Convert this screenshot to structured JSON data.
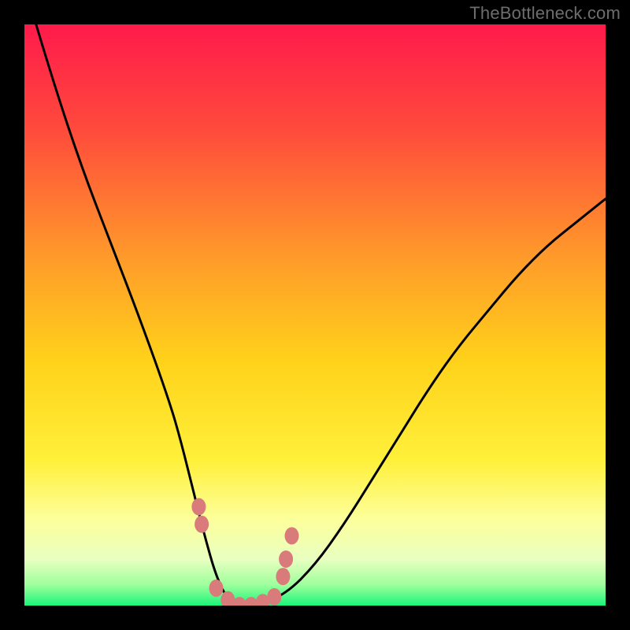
{
  "watermark": "TheBottleneck.com",
  "colors": {
    "frame": "#000000",
    "gradient_top": "#ff1a4b",
    "gradient_mid1": "#ff7a2f",
    "gradient_mid2": "#ffd21a",
    "gradient_mid3": "#fff47a",
    "gradient_pale": "#f5ffc8",
    "gradient_bottom": "#19f57a",
    "curve": "#000000",
    "markers": "#d97b7b"
  },
  "chart_data": {
    "type": "line",
    "title": "",
    "xlabel": "",
    "ylabel": "",
    "xlim": [
      0,
      100
    ],
    "ylim": [
      0,
      100
    ],
    "grid": false,
    "legend": false,
    "series": [
      {
        "name": "bottleneck-curve",
        "x": [
          2,
          5,
          10,
          15,
          20,
          25,
          27,
          29,
          31,
          33,
          35,
          37,
          40,
          45,
          50,
          55,
          60,
          65,
          70,
          75,
          80,
          85,
          90,
          95,
          100
        ],
        "y": [
          100,
          90,
          75,
          62,
          49,
          35,
          28,
          20,
          12,
          5,
          1,
          0,
          0,
          2,
          7,
          14,
          22,
          30,
          38,
          45,
          51,
          57,
          62,
          66,
          70
        ]
      }
    ],
    "markers": [
      {
        "x": 30,
        "y": 17
      },
      {
        "x": 30.5,
        "y": 14
      },
      {
        "x": 33,
        "y": 3
      },
      {
        "x": 35,
        "y": 1
      },
      {
        "x": 37,
        "y": 0
      },
      {
        "x": 39,
        "y": 0
      },
      {
        "x": 41,
        "y": 0.5
      },
      {
        "x": 43,
        "y": 1.5
      },
      {
        "x": 44.5,
        "y": 5
      },
      {
        "x": 45,
        "y": 8
      },
      {
        "x": 46,
        "y": 12
      }
    ]
  }
}
